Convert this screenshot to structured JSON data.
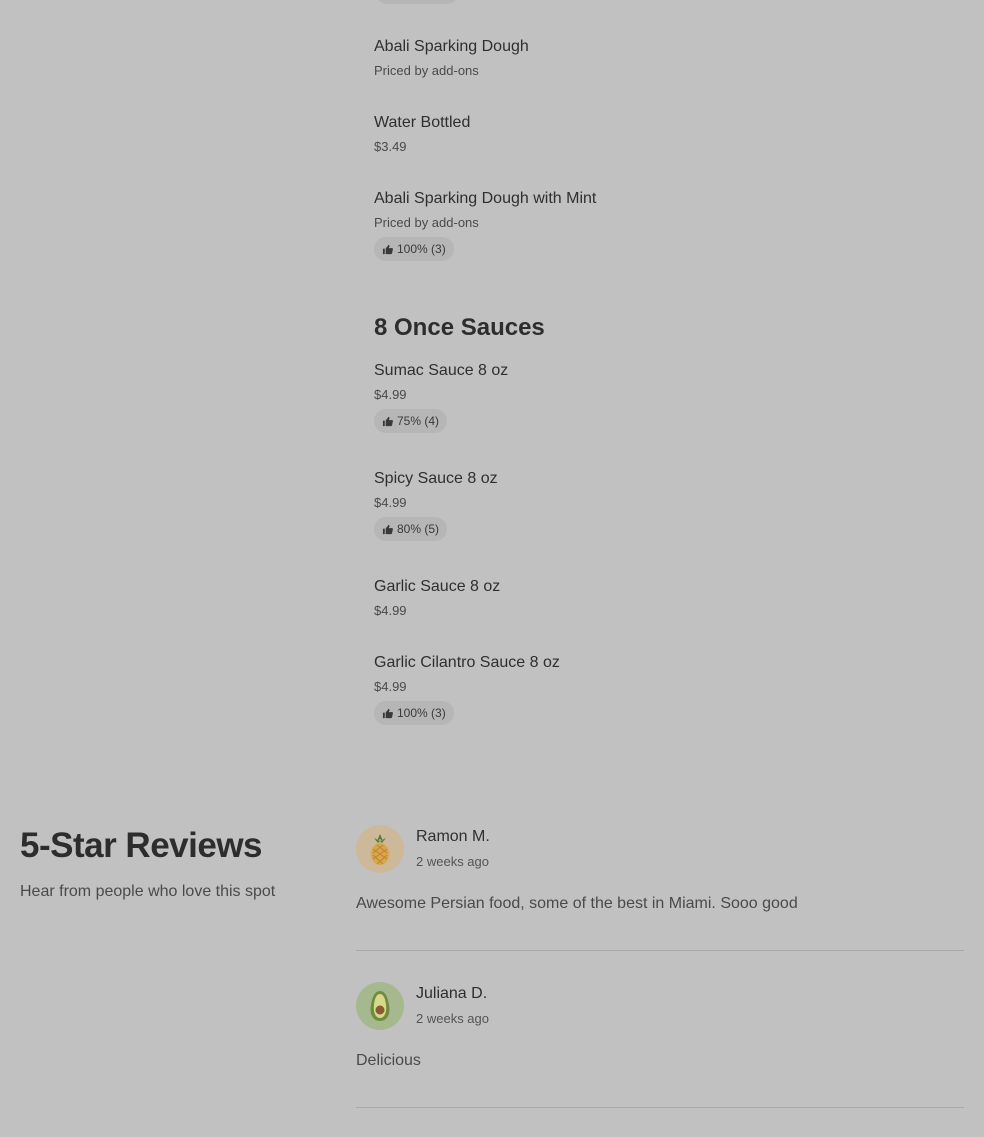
{
  "menu": {
    "items_top": [
      {
        "name": "Abali Sparking Dough",
        "price": "Priced by add-ons"
      },
      {
        "name": "Water Bottled",
        "price": "$3.49"
      },
      {
        "name": "Abali Sparking Dough with Mint",
        "price": "Priced by add-ons",
        "rating": "100% (3)"
      }
    ],
    "sauces_section": {
      "title": "8 Once Sauces",
      "items": [
        {
          "name": "Sumac Sauce 8 oz",
          "price": "$4.99",
          "rating": "75% (4)"
        },
        {
          "name": "Spicy Sauce 8 oz",
          "price": "$4.99",
          "rating": "80% (5)"
        },
        {
          "name": "Garlic Sauce 8 oz",
          "price": "$4.99"
        },
        {
          "name": "Garlic Cilantro Sauce 8 oz",
          "price": "$4.99",
          "rating": "100% (3)"
        }
      ]
    }
  },
  "reviews": {
    "title": "5-Star Reviews",
    "subtitle": "Hear from people who love this spot",
    "list": [
      {
        "name": "Ramon M.",
        "time": "2 weeks ago",
        "text": "Awesome Persian food, some of the best in Miami. Sooo good",
        "avatar_icon": "pineapple-icon",
        "avatar_bg": "#cdb99a"
      },
      {
        "name": "Juliana D.",
        "time": "2 weeks ago",
        "text": "Delicious",
        "avatar_icon": "avocado-icon",
        "avatar_bg": "#a6b98e"
      }
    ]
  },
  "colors": {
    "overlay_bg": "#c1c1c1",
    "pill_bg": "#b6b6b6",
    "text_dark": "#2d2d2d"
  }
}
